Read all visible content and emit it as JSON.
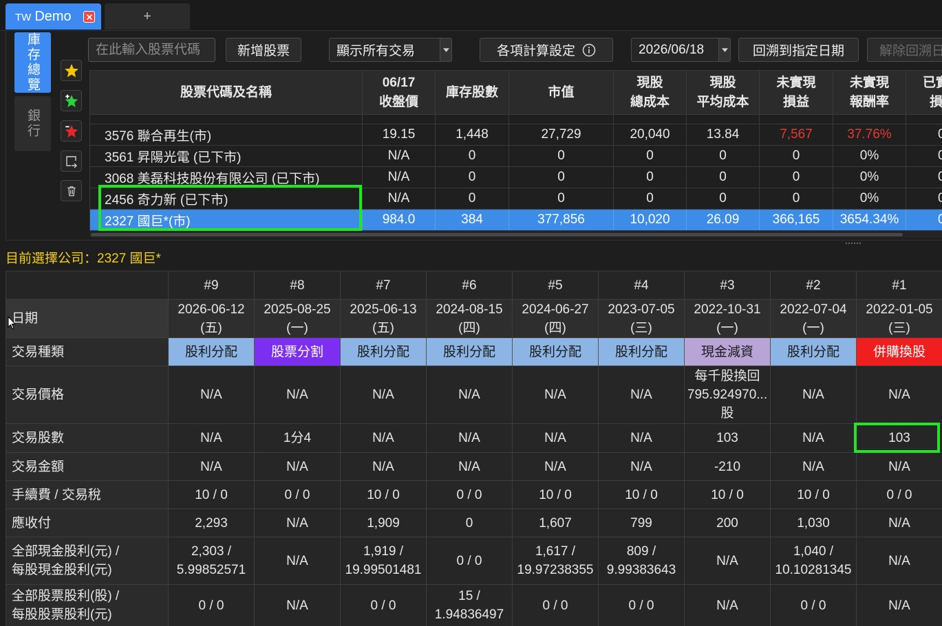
{
  "window": {
    "tab": {
      "prefix": "TW",
      "name": "Demo"
    },
    "new_tab": "+"
  },
  "sidebar": {
    "tabs": [
      {
        "label": "庫存總覽",
        "active": true
      },
      {
        "label": "銀行",
        "active": false
      }
    ],
    "tools": [
      "star-icon",
      "add-star-icon",
      "remove-star-icon",
      "export-icon",
      "trash-icon"
    ]
  },
  "toolbar": {
    "search_placeholder": "在此輸入股票代碼",
    "add_stock": "新增股票",
    "filter_selected": "顯示所有交易",
    "settings": "各項計算設定",
    "date_selected": "2026/06/18",
    "backtrack": "回溯到指定日期",
    "clear_backtrack": "解除回溯日"
  },
  "holdings": {
    "columns": [
      {
        "lines": [
          "股票代碼及名稱"
        ]
      },
      {
        "lines": [
          "06/17",
          "收盤價"
        ]
      },
      {
        "lines": [
          "庫存股數"
        ]
      },
      {
        "lines": [
          "市值"
        ]
      },
      {
        "lines": [
          "現股",
          "總成本"
        ]
      },
      {
        "lines": [
          "現股",
          "平均成本"
        ]
      },
      {
        "lines": [
          "未實現",
          "損益"
        ]
      },
      {
        "lines": [
          "未實現",
          "報酬率"
        ]
      },
      {
        "lines": [
          "已實",
          "損"
        ]
      }
    ],
    "rows": [
      {
        "cells": [
          "3576 聯合再生(市)",
          "19.15",
          "1,448",
          "27,729",
          "20,040",
          "13.84",
          {
            "text": "7,567",
            "color": "#e53935"
          },
          {
            "text": "37.76%",
            "color": "#e53935"
          },
          "0"
        ]
      },
      {
        "cells": [
          "3561 昇陽光電 (已下市)",
          "N/A",
          "0",
          "0",
          "0",
          "0",
          "0",
          "0%",
          "0"
        ]
      },
      {
        "cells": [
          "3068 美磊科技股份有限公司 (已下市)",
          "N/A",
          "0",
          "0",
          "0",
          "0",
          "0",
          "0%",
          "0"
        ]
      },
      {
        "cells": [
          "2456 奇力新 (已下市)",
          "N/A",
          "0",
          "0",
          "0",
          "0",
          "0",
          "0%",
          "0"
        ]
      },
      {
        "cells": [
          "2327 國巨*(市)",
          "984.0",
          "384",
          "377,856",
          "10,020",
          "26.09",
          "366,165",
          "3654.34%",
          "0"
        ],
        "selected": true
      }
    ]
  },
  "selected_company": "目前選擇公司：2327 國巨*",
  "transactions": {
    "row_labels": [
      [
        "日期"
      ],
      [
        "交易種類"
      ],
      [
        "交易價格"
      ],
      [
        "交易股數"
      ],
      [
        "交易金額"
      ],
      [
        "手續費 / 交易稅"
      ],
      [
        "應收付"
      ],
      [
        "全部現金股利(元) /",
        "每股現金股利(元)"
      ],
      [
        "全部股票股利(股) /",
        "每股股票股利(元)"
      ]
    ],
    "type_colors": {
      "股利分配": {
        "bg": "#8cb4e4",
        "fg": "#1b1b1b"
      },
      "股票分割": {
        "bg": "#7c2ff0",
        "fg": "#ffffff"
      },
      "現金減資": {
        "bg": "#b9a4d8",
        "fg": "#1b1b1b"
      },
      "併購換股": {
        "bg": "#f01e1e",
        "fg": "#ffffff"
      }
    },
    "records": [
      {
        "id": "#9",
        "date": "2026-06-12",
        "weekday": "(五)",
        "type": "股利分配",
        "price": [
          "N/A"
        ],
        "shares": [
          "N/A"
        ],
        "amount": [
          "N/A"
        ],
        "fee_tax": [
          "10 / 0"
        ],
        "payable": [
          "2,293"
        ],
        "cash_dividend": [
          "2,303 /",
          "5.99852571"
        ],
        "stock_dividend": [
          "0 / 0"
        ]
      },
      {
        "id": "#8",
        "date": "2025-08-25",
        "weekday": "(一)",
        "type": "股票分割",
        "price": [
          "N/A"
        ],
        "shares": [
          "1分4"
        ],
        "amount": [
          "N/A"
        ],
        "fee_tax": [
          "0 / 0"
        ],
        "payable": [
          "N/A"
        ],
        "cash_dividend": [
          "N/A"
        ],
        "stock_dividend": [
          "N/A"
        ]
      },
      {
        "id": "#7",
        "date": "2025-06-13",
        "weekday": "(五)",
        "type": "股利分配",
        "price": [
          "N/A"
        ],
        "shares": [
          "N/A"
        ],
        "amount": [
          "N/A"
        ],
        "fee_tax": [
          "10 / 0"
        ],
        "payable": [
          "1,909"
        ],
        "cash_dividend": [
          "1,919 /",
          "19.99501481"
        ],
        "stock_dividend": [
          "0 / 0"
        ]
      },
      {
        "id": "#6",
        "date": "2024-08-15",
        "weekday": "(四)",
        "type": "股利分配",
        "price": [
          "N/A"
        ],
        "shares": [
          "N/A"
        ],
        "amount": [
          "N/A"
        ],
        "fee_tax": [
          "0 / 0"
        ],
        "payable": [
          "0"
        ],
        "cash_dividend": [
          "0 / 0"
        ],
        "stock_dividend": [
          "15 /",
          "1.94836497"
        ]
      },
      {
        "id": "#5",
        "date": "2024-06-27",
        "weekday": "(四)",
        "type": "股利分配",
        "price": [
          "N/A"
        ],
        "shares": [
          "N/A"
        ],
        "amount": [
          "N/A"
        ],
        "fee_tax": [
          "10 / 0"
        ],
        "payable": [
          "1,607"
        ],
        "cash_dividend": [
          "1,617 /",
          "19.97238355"
        ],
        "stock_dividend": [
          "0 / 0"
        ]
      },
      {
        "id": "#4",
        "date": "2023-07-05",
        "weekday": "(三)",
        "type": "股利分配",
        "price": [
          "N/A"
        ],
        "shares": [
          "N/A"
        ],
        "amount": [
          "N/A"
        ],
        "fee_tax": [
          "10 / 0"
        ],
        "payable": [
          "799"
        ],
        "cash_dividend": [
          "809 /",
          "9.99383643"
        ],
        "stock_dividend": [
          "0 / 0"
        ]
      },
      {
        "id": "#3",
        "date": "2022-10-31",
        "weekday": "(一)",
        "type": "現金減資",
        "price": [
          "每千股換回",
          "795.924970...",
          "股"
        ],
        "shares": [
          "103"
        ],
        "amount": [
          "-210"
        ],
        "fee_tax": [
          "10 / 0"
        ],
        "payable": [
          "200"
        ],
        "cash_dividend": [
          "N/A"
        ],
        "stock_dividend": [
          "N/A"
        ]
      },
      {
        "id": "#2",
        "date": "2022-07-04",
        "weekday": "(一)",
        "type": "股利分配",
        "price": [
          "N/A"
        ],
        "shares": [
          "N/A"
        ],
        "amount": [
          "N/A"
        ],
        "fee_tax": [
          "10 / 0"
        ],
        "payable": [
          "1,030"
        ],
        "cash_dividend": [
          "1,040 /",
          "10.10281345"
        ],
        "stock_dividend": [
          "0 / 0"
        ]
      },
      {
        "id": "#1",
        "date": "2022-01-05",
        "weekday": "(三)",
        "type": "併購換股",
        "price": [
          "N/A"
        ],
        "shares": [
          "103"
        ],
        "amount": [
          "N/A"
        ],
        "fee_tax": [
          "0 / 0"
        ],
        "payable": [
          "N/A"
        ],
        "cash_dividend": [
          "N/A"
        ],
        "stock_dividend": [
          "N/A"
        ]
      }
    ]
  },
  "colors": {
    "accent": "#3d8bf2",
    "selected_row": "#3d8de8",
    "gain": "#e53935",
    "selected_company_text": "#f3cf0d",
    "highlight_box": "#22e622"
  }
}
